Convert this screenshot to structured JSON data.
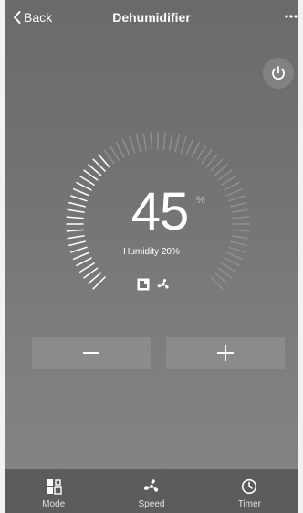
{
  "header": {
    "back_label": "Back",
    "title": "Dehumidifier"
  },
  "main": {
    "humidity_value": "45",
    "unit": "%",
    "humidity_text": "Humidity 20%",
    "dial_level": 0.35
  },
  "controls": {
    "minus_icon": "minus-icon",
    "plus_icon": "plus-icon"
  },
  "bottom_bar": {
    "tabs": [
      {
        "label": "Mode",
        "icon": "mode-icon"
      },
      {
        "label": "Speed",
        "icon": "fan-icon"
      },
      {
        "label": "Timer",
        "icon": "clock-icon"
      }
    ]
  },
  "colors": {
    "background": "#737373",
    "bottom_bar": "#5c5c5c",
    "button": "#8b8b8b",
    "text": "#ffffff"
  }
}
